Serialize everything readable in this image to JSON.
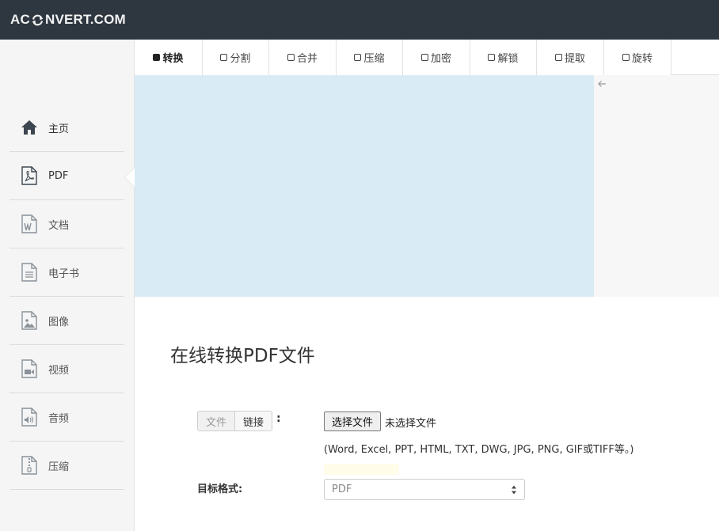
{
  "header": {
    "logo_prefix": "AC",
    "logo_suffix": "NVERT.COM",
    "logo_icon": "refresh-o-icon"
  },
  "sidebar": {
    "items": [
      {
        "label": "主页",
        "icon": "home-icon"
      },
      {
        "label": "PDF",
        "icon": "pdf-file-icon"
      },
      {
        "label": "文档",
        "icon": "word-document-icon"
      },
      {
        "label": "电子书",
        "icon": "ebook-file-icon"
      },
      {
        "label": "图像",
        "icon": "image-file-icon"
      },
      {
        "label": "视频",
        "icon": "video-file-icon"
      },
      {
        "label": "音频",
        "icon": "audio-file-icon"
      },
      {
        "label": "压缩",
        "icon": "archive-file-icon"
      }
    ],
    "active": "PDF"
  },
  "tabs": [
    {
      "label": "转换",
      "active": true
    },
    {
      "label": "分割",
      "active": false
    },
    {
      "label": "合并",
      "active": false
    },
    {
      "label": "压缩",
      "active": false
    },
    {
      "label": "加密",
      "active": false
    },
    {
      "label": "解锁",
      "active": false
    },
    {
      "label": "提取",
      "active": false
    },
    {
      "label": "旋转",
      "active": false
    }
  ],
  "main": {
    "title": "在线转换PDF文件",
    "source_toggle": {
      "file_label": "文件",
      "link_label": "链接",
      "colon": ":"
    },
    "file_button_label": "选择文件",
    "file_status": "未选择文件",
    "file_hint": "(Word, Excel, PPT, HTML, TXT, DWG, JPG, PNG, GIF或TIFF等。)",
    "target_label": "目标格式:",
    "target_value": "PDF"
  },
  "colors": {
    "topbar": "#2e3640",
    "ad_background": "#d9ecf5",
    "sidebar_background": "#f5f5f5"
  }
}
